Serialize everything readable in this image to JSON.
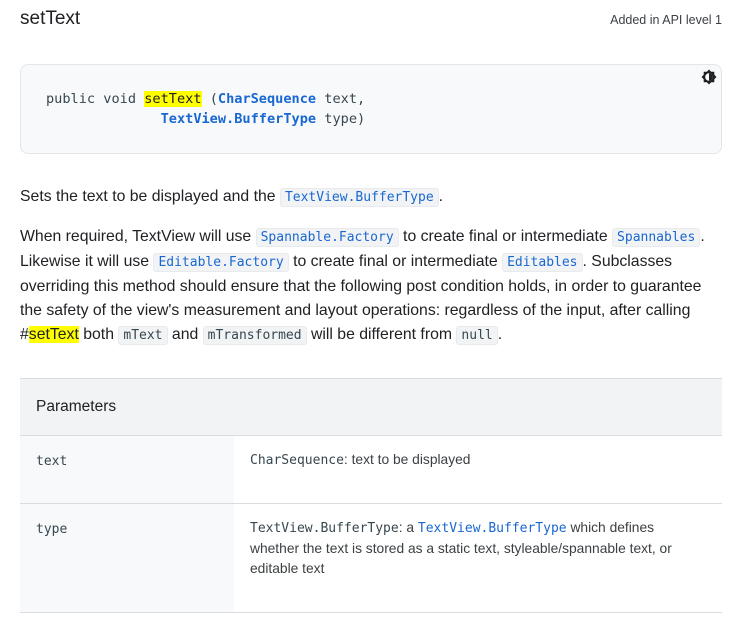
{
  "header": {
    "title": "setText",
    "api_level": "Added in API level 1"
  },
  "signature": {
    "line1_prefix": "public void ",
    "method": "setText",
    "line1_open": " (",
    "param1_type": "CharSequence",
    "param1_name": " text,",
    "indent": "              ",
    "param2_type": "TextView.BufferType",
    "param2_name": " type)",
    "theme_toggle_icon": "brightness-icon"
  },
  "description": {
    "p1": {
      "text_before": "Sets the text to be displayed and the ",
      "code": "TextView.BufferType",
      "text_after": "."
    },
    "p2": {
      "t1": "When required, TextView will use ",
      "c1": "Spannable.Factory",
      "t2": " to create final or intermediate ",
      "c2": "Spannables",
      "t3": ". Likewise it will use ",
      "c3": "Editable.Factory",
      "t4": " to create final or intermediate ",
      "c4": "Editables",
      "t5": ". Subclasses overriding this method should ensure that the following post condition holds, in order to guarantee the safety of the view's measurement and layout operations: regardless of the input, after calling #",
      "highlight": "setText",
      "t6": " both ",
      "c5": "mText",
      "t7": " and ",
      "c6": "mTransformed",
      "t8": " will be different from ",
      "c7": "null",
      "t9": "."
    }
  },
  "parameters": {
    "heading": "Parameters",
    "rows": [
      {
        "name": "text",
        "type": "CharSequence",
        "desc": ": text to be displayed"
      },
      {
        "name": "type",
        "type": "TextView.BufferType",
        "desc_mid": ": a ",
        "link": "TextView.BufferType",
        "desc": " which defines whether the text is stored as a static text, styleable/spannable text, or editable text"
      }
    ]
  },
  "colors": {
    "link": "#1967d2",
    "highlight": "#ffff00",
    "code_bg": "#f8f9fa",
    "table_header_bg": "#f1f3f4"
  }
}
